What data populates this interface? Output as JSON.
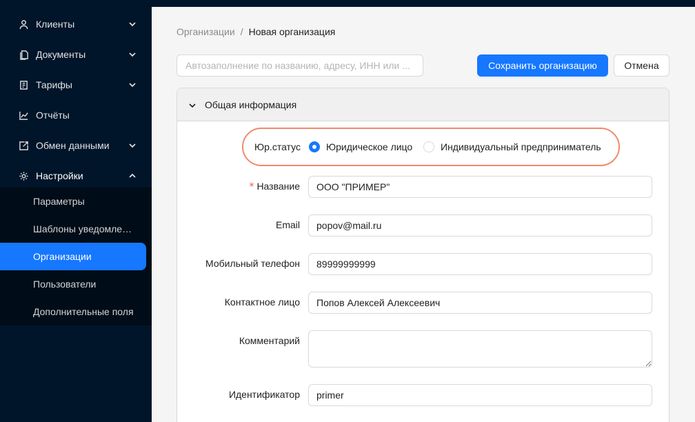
{
  "sidebar": {
    "items": [
      {
        "label": "Клиенты",
        "icon": "user-icon"
      },
      {
        "label": "Документы",
        "icon": "document-icon"
      },
      {
        "label": "Тарифы",
        "icon": "tariff-icon"
      },
      {
        "label": "Отчёты",
        "icon": "chart-icon"
      },
      {
        "label": "Обмен данными",
        "icon": "exchange-icon"
      },
      {
        "label": "Настройки",
        "icon": "gear-icon"
      }
    ],
    "submenu": [
      {
        "label": "Параметры"
      },
      {
        "label": "Шаблоны уведомлений"
      },
      {
        "label": "Организации"
      },
      {
        "label": "Пользователи"
      },
      {
        "label": "Дополнительные поля"
      }
    ]
  },
  "breadcrumb": {
    "parent": "Организации",
    "separator": "/",
    "current": "Новая организация"
  },
  "toolbar": {
    "search_placeholder": "Автозаполнение по названию, адресу, ИНН или ...",
    "save_label": "Сохранить организацию",
    "cancel_label": "Отмена"
  },
  "panel": {
    "title": "Общая информация",
    "status_label": "Юр.статус",
    "status_options": [
      {
        "label": "Юридическое лицо",
        "checked": true
      },
      {
        "label": "Индивидуальный предприниматель",
        "checked": false
      }
    ],
    "fields": {
      "name": {
        "label": "Название",
        "value": "ООО \"ПРИМЕР\"",
        "required_mark": "*"
      },
      "email": {
        "label": "Email",
        "value": "popov@mail.ru"
      },
      "phone": {
        "label": "Мобильный телефон",
        "value": "89999999999"
      },
      "contact": {
        "label": "Контактное лицо",
        "value": "Попов Алексей Алексеевич"
      },
      "comment": {
        "label": "Комментарий",
        "value": ""
      },
      "identifier": {
        "label": "Идентификатор",
        "value": "primer"
      }
    }
  },
  "colors": {
    "sidebar_bg": "#001529",
    "accent": "#1677ff",
    "highlight": "#f08a6a"
  }
}
